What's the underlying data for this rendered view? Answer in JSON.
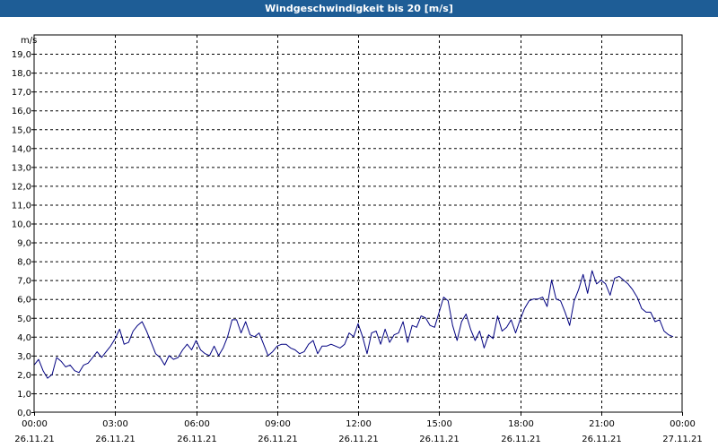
{
  "window": {
    "title": "Windgeschwindigkeit bis 20 [m/s]"
  },
  "chart_data": {
    "type": "line",
    "title": "Windgeschwindigkeit bis 20 [m/s]",
    "ylabel": "m/s",
    "xlabel": "",
    "ylim": [
      0,
      20
    ],
    "xlim_minutes": [
      0,
      1440
    ],
    "grid": true,
    "line_color": "#000080",
    "y_ticks": [
      "0,0",
      "1,0",
      "2,0",
      "3,0",
      "4,0",
      "5,0",
      "6,0",
      "7,0",
      "8,0",
      "9,0",
      "10,0",
      "11,0",
      "12,0",
      "13,0",
      "14,0",
      "15,0",
      "16,0",
      "17,0",
      "18,0",
      "19,0"
    ],
    "x_ticks": [
      {
        "time": "00:00",
        "date": "26.11.21"
      },
      {
        "time": "03:00",
        "date": "26.11.21"
      },
      {
        "time": "06:00",
        "date": "26.11.21"
      },
      {
        "time": "09:00",
        "date": "26.11.21"
      },
      {
        "time": "12:00",
        "date": "26.11.21"
      },
      {
        "time": "15:00",
        "date": "26.11.21"
      },
      {
        "time": "18:00",
        "date": "26.11.21"
      },
      {
        "time": "21:00",
        "date": "26.11.21"
      },
      {
        "time": "00:00",
        "date": "27.11.21"
      }
    ],
    "series": [
      {
        "x_time": [
          "00:00",
          "00:10",
          "00:20",
          "00:30",
          "00:40",
          "00:50",
          "01:00",
          "01:10",
          "01:20",
          "01:30",
          "01:40",
          "01:50",
          "02:00",
          "02:10",
          "02:20",
          "02:30",
          "02:40",
          "02:50",
          "03:00",
          "03:10",
          "03:20",
          "03:30",
          "03:40",
          "03:50",
          "04:00",
          "04:10",
          "04:20",
          "04:30",
          "04:40",
          "04:50",
          "05:00",
          "05:10",
          "05:20",
          "05:30",
          "05:40",
          "05:50",
          "06:00",
          "06:10",
          "06:20",
          "06:30",
          "06:40",
          "06:50",
          "07:00",
          "07:10",
          "07:20",
          "07:30",
          "07:40",
          "07:50",
          "08:00",
          "08:10",
          "08:20",
          "08:30",
          "08:40",
          "08:50",
          "09:00",
          "09:10",
          "09:20",
          "09:30",
          "09:40",
          "09:50",
          "10:00",
          "10:10",
          "10:20",
          "10:30",
          "10:40",
          "10:50",
          "11:00",
          "11:10",
          "11:20",
          "11:30",
          "11:40",
          "11:50",
          "12:00",
          "12:10",
          "12:20",
          "12:30",
          "12:40",
          "12:50",
          "13:00",
          "13:10",
          "13:20",
          "13:30",
          "13:40",
          "13:50",
          "14:00",
          "14:10",
          "14:20",
          "14:30",
          "14:40",
          "14:50",
          "15:00",
          "15:10",
          "15:20",
          "15:30",
          "15:40",
          "15:50",
          "16:00",
          "16:10",
          "16:20",
          "16:30",
          "16:40",
          "16:50",
          "17:00",
          "17:10",
          "17:20",
          "17:30",
          "17:40",
          "17:50",
          "18:00",
          "18:10",
          "18:20",
          "18:30",
          "18:40",
          "18:50",
          "19:00",
          "19:10",
          "19:20",
          "19:30",
          "19:40",
          "19:50",
          "20:00",
          "20:10",
          "20:20",
          "20:30",
          "20:40",
          "20:50",
          "21:00",
          "21:10",
          "21:20",
          "21:30",
          "21:40",
          "21:50",
          "22:00",
          "22:10",
          "22:20",
          "22:30",
          "22:40",
          "22:50",
          "23:00",
          "23:10",
          "23:20",
          "23:30",
          "23:40",
          "23:50",
          "24:00"
        ],
        "values": [
          2.5,
          2.8,
          2.2,
          1.8,
          2.0,
          2.9,
          2.7,
          2.4,
          2.5,
          2.2,
          2.1,
          2.5,
          2.6,
          2.9,
          3.2,
          2.9,
          3.2,
          3.5,
          3.9,
          4.4,
          3.6,
          3.7,
          4.3,
          4.6,
          4.8,
          4.3,
          3.7,
          3.1,
          2.9,
          2.5,
          3.0,
          2.8,
          2.9,
          3.3,
          3.6,
          3.3,
          3.8,
          3.3,
          3.1,
          3.0,
          3.5,
          3.0,
          3.4,
          4.0,
          4.9,
          4.9,
          4.2,
          4.8,
          4.1,
          4.0,
          4.2,
          3.6,
          3.0,
          3.2,
          3.5,
          3.6,
          3.6,
          3.4,
          3.3,
          3.1,
          3.2,
          3.6,
          3.8,
          3.1,
          3.5,
          3.5,
          3.6,
          3.5,
          3.4,
          3.6,
          4.2,
          4.0,
          4.7,
          4.0,
          3.1,
          4.2,
          4.3,
          3.6,
          4.4,
          3.7,
          4.1,
          4.2,
          4.8,
          3.7,
          4.6,
          4.5,
          5.1,
          5.0,
          4.6,
          4.5,
          5.3,
          6.1,
          5.9,
          4.6,
          3.8,
          4.8,
          5.2,
          4.4,
          3.8,
          4.3,
          3.4,
          4.1,
          3.9,
          5.1,
          4.3,
          4.5,
          4.9,
          4.2,
          4.9,
          5.5,
          5.9,
          6.0,
          6.0,
          6.1,
          5.6,
          7.0,
          6.0,
          5.9,
          5.3,
          4.6,
          5.9,
          6.5,
          7.3,
          6.3,
          7.5,
          6.8,
          7.0,
          6.8,
          6.2,
          7.1,
          7.2,
          7.0,
          6.8,
          6.5,
          6.1,
          5.5,
          5.3,
          5.3,
          4.8,
          4.9,
          4.3,
          4.1,
          4.0
        ]
      }
    ]
  }
}
